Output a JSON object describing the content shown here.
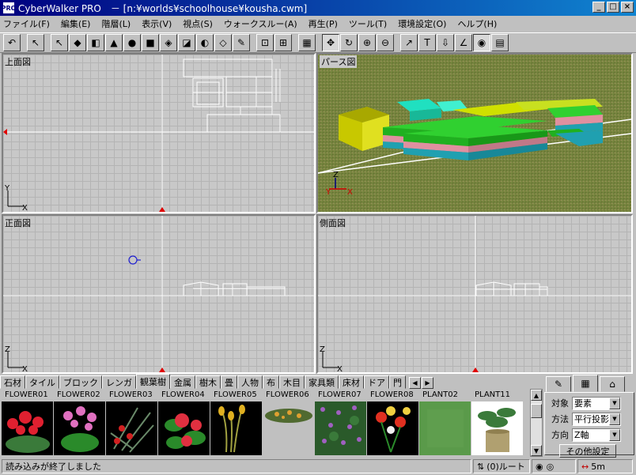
{
  "window": {
    "title": "CyberWalker PRO　－ [n:¥worlds¥schoolhouse¥kousha.cwm]",
    "app_icon": "PRO",
    "minimize": "_",
    "maximize": "□",
    "close": "×"
  },
  "menu": [
    "ファイル(F)",
    "編集(E)",
    "階層(L)",
    "表示(V)",
    "視点(S)",
    "ウォークスルー(A)",
    "再生(P)",
    "ツール(T)",
    "環境設定(O)",
    "ヘルプ(H)"
  ],
  "toolbar": {
    "icons": [
      "undo-icon",
      "pointer-icon",
      "select-pointer-icon",
      "floor-plate-icon",
      "wall-icon",
      "roof-icon",
      "sphere-icon",
      "cube-icon",
      "group-icon",
      "model-icon",
      "revolve-icon",
      "extrude-icon",
      "brush-icon",
      "fit-view-icon",
      "fit-all-icon",
      "grid-icon",
      "move-icon",
      "rotate-icon",
      "zoom-in-icon",
      "zoom-out-icon",
      "measure-icon",
      "text-icon",
      "light-icon",
      "line-icon",
      "camera-icon",
      "texture-icon"
    ],
    "glyphs": [
      "↶",
      "↖",
      "↖",
      "◆",
      "◧",
      "▲",
      "●",
      "■",
      "◈",
      "◪",
      "◐",
      "◇",
      "✎",
      "⊡",
      "⊞",
      "▦",
      "✥",
      "↻",
      "⊕",
      "⊖",
      "↗",
      "T",
      "⇩",
      "∠",
      "◉",
      "▤"
    ]
  },
  "views": {
    "top": "上面図",
    "persp": "パース図",
    "front": "正面図",
    "side": "側面図"
  },
  "axes": {
    "x": "X",
    "y": "Y",
    "z": "Z"
  },
  "colors": {
    "persp_ground": "#6f7e3a",
    "building_yellow": "#c8c800",
    "building_green": "#20c020",
    "building_pink": "#e090a0",
    "building_teal": "#20a0b0",
    "roof_cyan": "#20e0c0"
  },
  "tabs": [
    "石材",
    "タイル",
    "ブロック",
    "レンガ",
    "観葉樹",
    "金属",
    "樹木",
    "畳",
    "人物",
    "布",
    "木目",
    "家具類",
    "床材",
    "ドア",
    "門"
  ],
  "active_tab": "観葉樹",
  "tab_scroll": {
    "left": "◀",
    "right": "▶"
  },
  "materials": [
    "FLOWER01",
    "FLOWER02",
    "FLOWER03",
    "FLOWER04",
    "FLOWER05",
    "FLOWER06",
    "FLOWER07",
    "FLOWER08",
    "PLANT02",
    "PLANT11"
  ],
  "scroll": {
    "up": "▲",
    "down": "▼"
  },
  "right_panel": {
    "tab_icons": [
      "paint-icon",
      "texture-map-icon",
      "house-icon"
    ],
    "tab_glyphs": [
      "✎",
      "▦",
      "⌂"
    ],
    "rows": [
      {
        "label": "対象",
        "value": "要素"
      },
      {
        "label": "方法",
        "value": "平行投影"
      },
      {
        "label": "方向",
        "value": "Z軸"
      }
    ],
    "more_button": "その他設定"
  },
  "status": {
    "message": "読み込みが終了しました",
    "root": "(0)ルート",
    "scale": "5m"
  }
}
